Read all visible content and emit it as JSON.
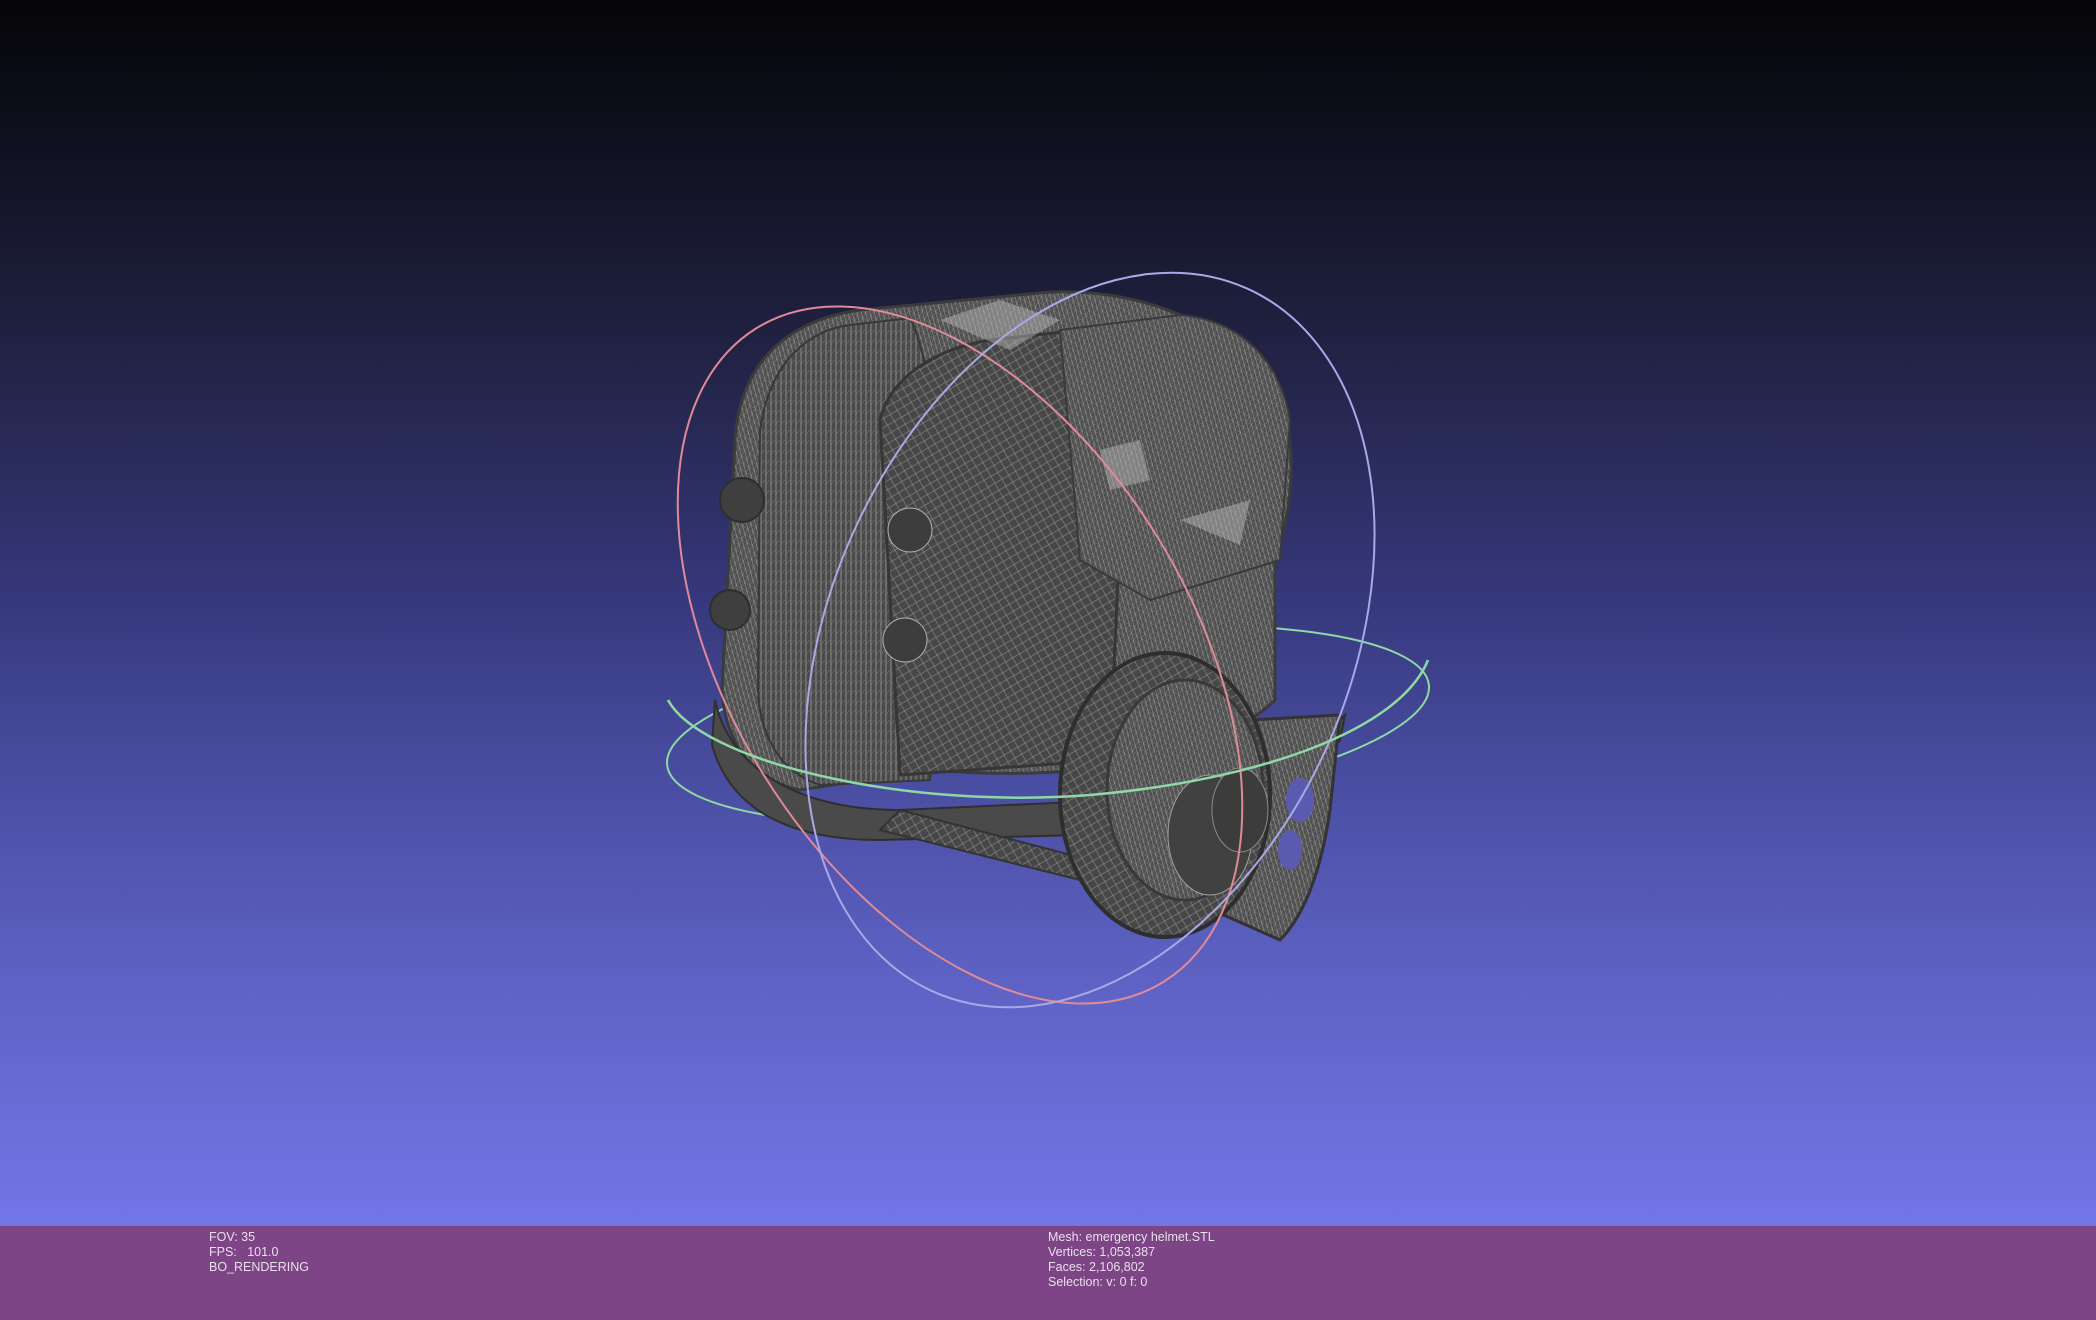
{
  "viewer": {
    "background_top": "#050508",
    "background_bottom": "#7276e7",
    "info_bar_color": "#7d4585",
    "mesh_color": "#4a4a4a",
    "trackball_colors": {
      "x_axis": "#e08a98",
      "y_axis": "#a9a8e8",
      "z_axis": "#8fd8a6"
    }
  },
  "info_left": {
    "fov": "FOV: 35",
    "fps": "FPS:   101.0",
    "mode": "BO_RENDERING"
  },
  "info_right": {
    "mesh": "Mesh: emergency helmet.STL",
    "vertices": "Vertices: 1,053,387",
    "faces": "Faces: 2,106,802",
    "selection": "Selection: v: 0 f: 0"
  }
}
